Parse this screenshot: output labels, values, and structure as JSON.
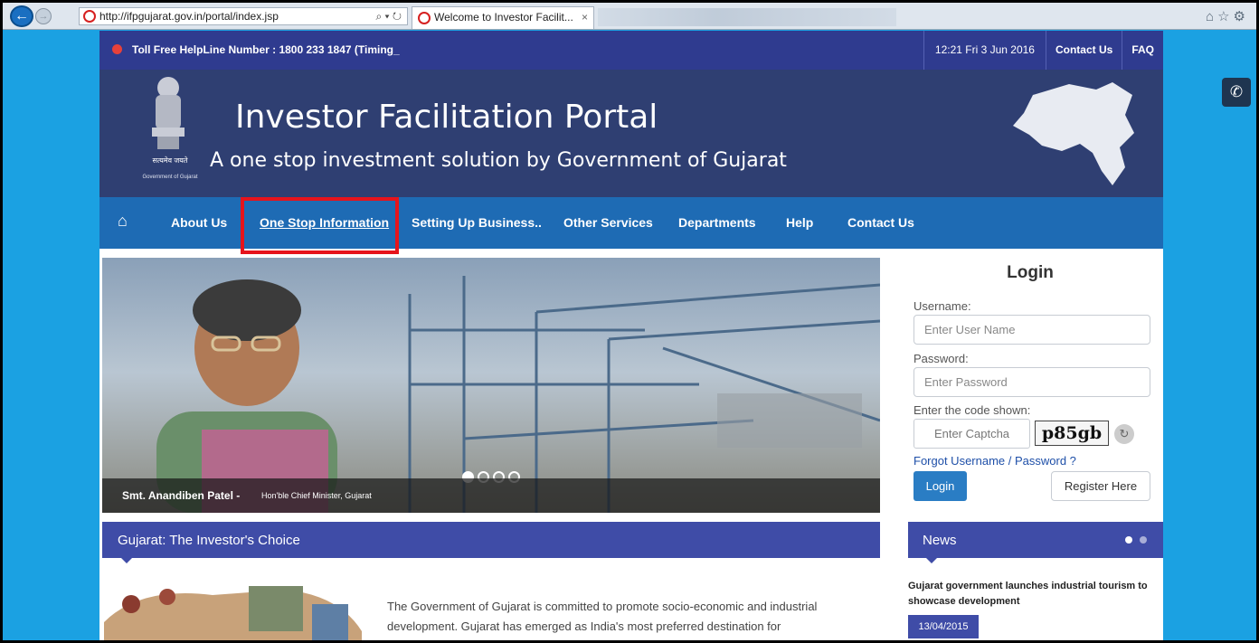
{
  "browser": {
    "url": "http://ifpgujarat.gov.in/portal/index.jsp",
    "search_controls": "⌕ ▾ ↻",
    "tab_title": "Welcome to Investor Facilit...",
    "tab_close": "×"
  },
  "topbar": {
    "helpline": "Toll Free HelpLine Number : 1800 233 1847 (Timing_",
    "datetime": "12:21  Fri  3 Jun 2016",
    "contact": "Contact Us",
    "faq": "FAQ"
  },
  "header": {
    "title": "Investor Facilitation Portal",
    "subtitle": "A one stop investment solution by Government of Gujarat",
    "emblem_caption_hindi": "सत्यमेव जयते",
    "emblem_caption": "Government of Gujarat"
  },
  "nav": {
    "items": [
      "About Us",
      "One Stop Information",
      "Setting Up Business..",
      "Other Services",
      "Departments",
      "Help",
      "Contact Us"
    ]
  },
  "banner": {
    "name": "Smt. Anandiben Patel - ",
    "role": "Hon'ble Chief Minister, Gujarat"
  },
  "login": {
    "heading": "Login",
    "username_label": "Username:",
    "username_placeholder": "Enter User Name",
    "password_label": "Password:",
    "password_placeholder": "Enter Password",
    "code_label": "Enter the code shown:",
    "captcha_placeholder": "Enter Captcha",
    "captcha_text": "p85gb",
    "forgot": "Forgot Username / Password ?",
    "login_button": "Login",
    "register_button": "Register Here"
  },
  "section": {
    "title": "Gujarat: The Investor's Choice",
    "body": "The Government of Gujarat is committed to promote socio-economic and industrial development. Gujarat has emerged as India's most preferred destination for"
  },
  "news": {
    "title": "News",
    "headline": "Gujarat government launches industrial tourism to showcase development",
    "date": "13/04/2015"
  },
  "colors": {
    "page_bg": "#1ba1e2",
    "topbar": "#2f3b8f",
    "header": "#2f3f72",
    "nav": "#1e6bb4",
    "section_bar": "#3f4ca7",
    "highlight": "#e6141c"
  }
}
